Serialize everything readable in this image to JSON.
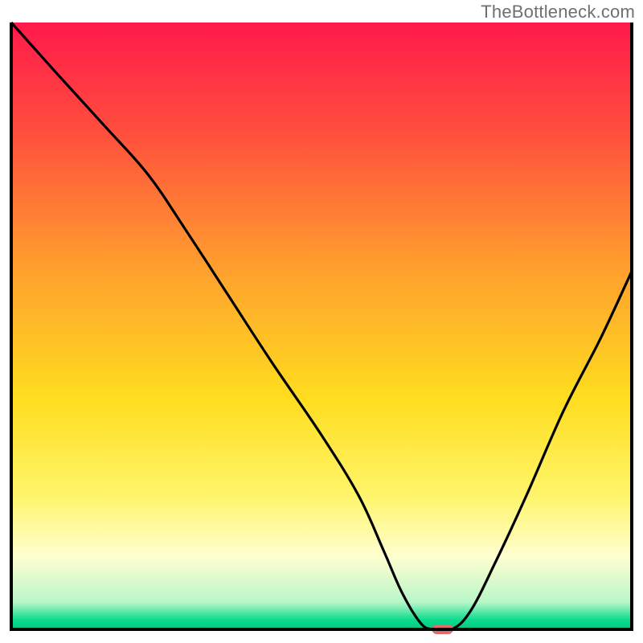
{
  "attribution": "TheBottleneck.com",
  "chart_data": {
    "type": "line",
    "title": "",
    "xlabel": "",
    "ylabel": "",
    "xlim": [
      0,
      100
    ],
    "ylim": [
      0,
      100
    ],
    "grid": false,
    "legend": false,
    "background_gradient_stops": [
      {
        "offset": 0.0,
        "color": "#ff1a4b"
      },
      {
        "offset": 0.18,
        "color": "#ff4e3d"
      },
      {
        "offset": 0.4,
        "color": "#ff9e2e"
      },
      {
        "offset": 0.62,
        "color": "#ffdd1f"
      },
      {
        "offset": 0.78,
        "color": "#fff56a"
      },
      {
        "offset": 0.88,
        "color": "#fffed0"
      },
      {
        "offset": 0.955,
        "color": "#b9f7c8"
      },
      {
        "offset": 0.985,
        "color": "#08db8c"
      },
      {
        "offset": 1.0,
        "color": "#07c97f"
      }
    ],
    "series": [
      {
        "name": "bottleneck-curve",
        "color": "#000000",
        "x": [
          0,
          7,
          15,
          22,
          28,
          35,
          42,
          50,
          56,
          60,
          63,
          66,
          68,
          71,
          74,
          78,
          83,
          89,
          95,
          100
        ],
        "y": [
          100,
          92,
          83,
          75,
          66,
          55,
          44,
          32,
          22,
          13,
          6,
          1,
          0,
          0,
          3,
          11,
          22,
          36,
          48,
          59
        ]
      }
    ],
    "marker": {
      "name": "optimal-point",
      "x": 69.5,
      "y": 0.0,
      "color": "#e26b6b",
      "shape": "rounded-rect",
      "width": 3.4,
      "height": 1.6
    }
  }
}
